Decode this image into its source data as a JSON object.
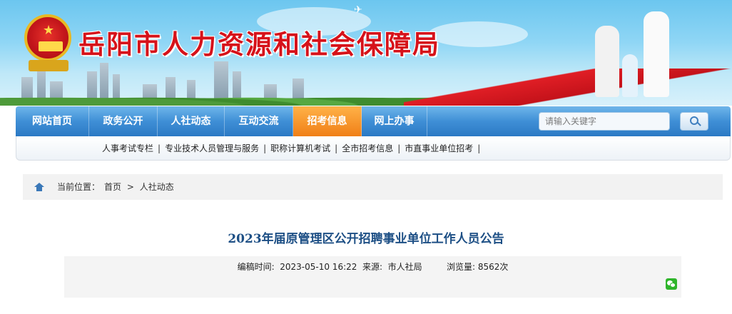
{
  "header": {
    "site_title": "岳阳市人力资源和社会保障局"
  },
  "nav": {
    "items": [
      {
        "label": "网站首页",
        "active": false
      },
      {
        "label": "政务公开",
        "active": false
      },
      {
        "label": "人社动态",
        "active": false
      },
      {
        "label": "互动交流",
        "active": false
      },
      {
        "label": "招考信息",
        "active": true
      },
      {
        "label": "网上办事",
        "active": false
      }
    ],
    "search_placeholder": "请输入关键字",
    "active_color": "#f07f17",
    "bar_color": "#3f8fd6"
  },
  "subnav": {
    "links": [
      "人事考试专栏",
      "专业技术人员管理与服务",
      "职称计算机考试",
      "全市招考信息",
      "市直事业单位招考"
    ],
    "separator": "|"
  },
  "breadcrumb": {
    "label": "当前位置：",
    "home": "首页",
    "arrow": ">",
    "current": "人社动态"
  },
  "article": {
    "title": "2023年届原管理区公开招聘事业单位工作人员公告",
    "meta": "编稿时间:  2023-05-10 16:22  来源:  市人社局         浏览量: 8562次"
  },
  "colors": {
    "title_red": "#d6121a",
    "article_title": "#1d4f85"
  }
}
